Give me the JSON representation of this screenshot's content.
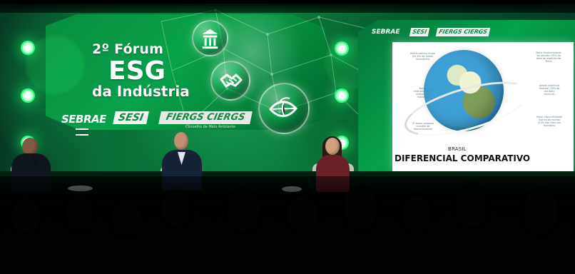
{
  "event": {
    "title_line1": "2º Fórum",
    "title_line2": "ESG",
    "title_line3": "da Indústria"
  },
  "partners": {
    "sebrae": "SEBRAE",
    "sesi": "SESI",
    "fiergs_ciergs": "FIERGS CIERGS",
    "caption": "Conselho de Meio Ambiente"
  },
  "screen": {
    "logos": {
      "sebrae": "SEBRAE",
      "sesi": "SESI",
      "fiergs_ciergs": "FIERGS CIERGS"
    },
    "slide": {
      "country": "BRASIL",
      "headline": "DIFERENCIAL COMPARATIVO",
      "notes": {
        "left_top": "Matriz elétrica limpa\n(84,8% de fontes\nrenováveis)",
        "left_mid": "Baixa\nintensidade de\ncarbono da\nindústria",
        "left_bottom": "3º maior produtor\nmundial de\nbiocombustível",
        "right_top": "Maior biodiversidade\ndo planeta (20% do\ntotal de espécies da\nTerra)",
        "right_mid": "Ampla cobertura\nflorestal (59% do\nterritório\nnacional)",
        "right_bottom": "Maior disponibilidade\nhídrica do mundo\n(12% das reservas\nmundiais)"
      }
    }
  },
  "icons": {
    "museum": "museum-icon",
    "handshake": "handshake-icon",
    "leaf": "leaf-icon"
  },
  "colors": {
    "brand_green": "#0a8e42",
    "light_green": "#28d56f",
    "dark_green": "#063a24",
    "slide_white": "#ffffff"
  }
}
